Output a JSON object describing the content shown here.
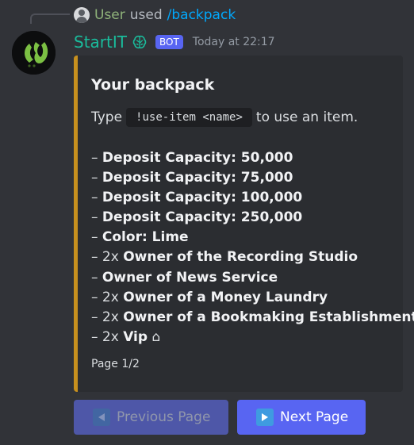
{
  "reply": {
    "user": "User",
    "used": "used",
    "command": "/backpack"
  },
  "message": {
    "author": "StartIT",
    "bot_badge": "BOT",
    "timestamp": "Today at 22:17",
    "author_color": "#1abc9c",
    "brain_icon": "brain-icon"
  },
  "embed": {
    "accent_color": "#c7901e",
    "title": "Your backpack",
    "desc_pre": "Type",
    "desc_code": "!use-item <name>",
    "desc_post": "to use an item.",
    "items": [
      {
        "dash": "– ",
        "qty": "",
        "name": "Deposit Capacity: 50,000"
      },
      {
        "dash": "– ",
        "qty": "",
        "name": "Deposit Capacity: 75,000"
      },
      {
        "dash": "– ",
        "qty": "",
        "name": "Deposit Capacity: 100,000"
      },
      {
        "dash": "– ",
        "qty": "",
        "name": "Deposit Capacity: 250,000"
      },
      {
        "dash": "– ",
        "qty": "",
        "name": "Color: Lime"
      },
      {
        "dash": "– ",
        "qty": "2x ",
        "name": "Owner of the Recording Studio"
      },
      {
        "dash": "– ",
        "qty": "",
        "name": "Owner of News Service"
      },
      {
        "dash": "– ",
        "qty": "2x ",
        "name": "Owner of a Money Laundry"
      },
      {
        "dash": "– ",
        "qty": "2x ",
        "name": "Owner of a Bookmaking Establishment"
      },
      {
        "dash": "– ",
        "qty": "2x ",
        "name": "Vip",
        "suffix": " ⌂"
      }
    ],
    "footer": "Page 1/2"
  },
  "buttons": {
    "prev_label": "Previous Page",
    "next_label": "Next Page",
    "prev_icon": "arrow-left-icon",
    "next_icon": "arrow-right-icon"
  }
}
